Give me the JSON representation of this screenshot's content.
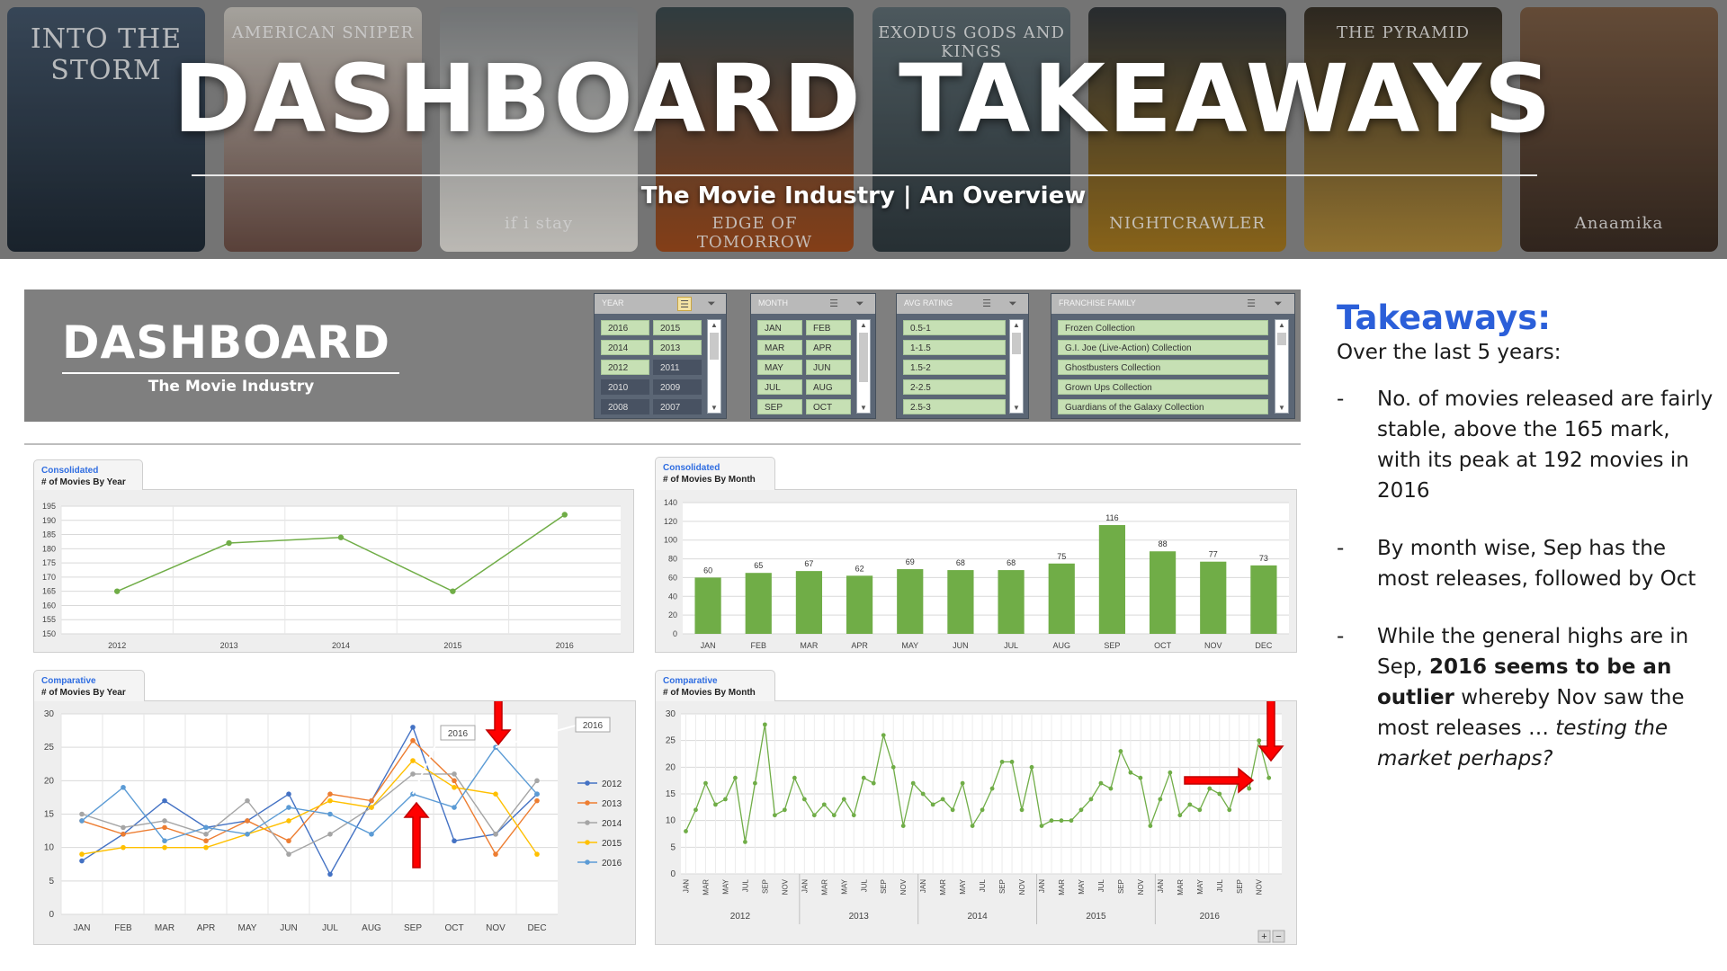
{
  "banner": {
    "title": "DASHBOARD TAKEAWAYS",
    "subtitle": "The Movie Industry | An Overview",
    "posters": [
      {
        "caption": "INTO THE STORM",
        "color_top": "#44566a",
        "color_bottom": "#1f2a35"
      },
      {
        "caption": "AMERICAN SNIPER",
        "color_top": "#c9c6bf",
        "color_bottom": "#6d4f46"
      },
      {
        "caption": "if i stay",
        "color_top": "#8a8d8f",
        "color_bottom": "#e5e2dc"
      },
      {
        "caption": "EDGE OF TOMORROW",
        "color_top": "#3a4a4e",
        "color_bottom": "#a14c1d"
      },
      {
        "caption": "EXODUS GODS AND KINGS",
        "color_top": "#5e6d73",
        "color_bottom": "#2f3a3f"
      },
      {
        "caption": "NIGHTCRAWLER",
        "color_top": "#30353a",
        "color_bottom": "#a6791f"
      },
      {
        "caption": "THE PYRAMID",
        "color_top": "#363028",
        "color_bottom": "#b08a3a"
      },
      {
        "caption": "Anaamika",
        "color_top": "#7a5c44",
        "color_bottom": "#3b2d24"
      }
    ]
  },
  "dashboard": {
    "title": "DASHBOARD",
    "subtitle": "The Movie Industry",
    "slicers": {
      "year": {
        "title": "YEAR",
        "items": [
          "2016",
          "2015",
          "2014",
          "2013",
          "2012",
          "2011",
          "2010",
          "2009",
          "2008",
          "2007"
        ],
        "selected": [
          "2016",
          "2015",
          "2014",
          "2013",
          "2012"
        ]
      },
      "month": {
        "title": "MONTH",
        "items": [
          "JAN",
          "FEB",
          "MAR",
          "APR",
          "MAY",
          "JUN",
          "JUL",
          "AUG",
          "SEP",
          "OCT"
        ]
      },
      "rating": {
        "title": "AVG RATING",
        "items": [
          "0.5-1",
          "1-1.5",
          "1.5-2",
          "2-2.5",
          "2.5-3"
        ]
      },
      "franchise": {
        "title": "FRANCHISE FAMILY",
        "items": [
          "Frozen Collection",
          "G.I. Joe (Live-Action) Collection",
          "Ghostbusters Collection",
          "Grown Ups Collection",
          "Guardians of the Galaxy Collection"
        ]
      }
    }
  },
  "panels": {
    "by_year": {
      "kicker": "Consolidated",
      "title": "# of Movies By Year"
    },
    "by_month": {
      "kicker": "Consolidated",
      "title": "# of Movies By Month"
    },
    "comp_year": {
      "kicker": "Comparative",
      "title": "# of Movies By Year"
    },
    "comp_month": {
      "kicker": "Comparative",
      "title": "# of Movies By Month"
    }
  },
  "chart_data": [
    {
      "type": "line",
      "title": "# of Movies By Year",
      "x": [
        "2012",
        "2013",
        "2014",
        "2015",
        "2016"
      ],
      "values": [
        165,
        182,
        184,
        165,
        192
      ],
      "ylim": [
        150,
        195
      ],
      "yticks": [
        150,
        155,
        160,
        165,
        170,
        175,
        180,
        185,
        190,
        195
      ],
      "color": "#70ad47",
      "grid": true
    },
    {
      "type": "bar",
      "title": "# of Movies By Month",
      "categories": [
        "JAN",
        "FEB",
        "MAR",
        "APR",
        "MAY",
        "JUN",
        "JUL",
        "AUG",
        "SEP",
        "OCT",
        "NOV",
        "DEC"
      ],
      "values": [
        60,
        65,
        67,
        62,
        69,
        68,
        68,
        75,
        116,
        88,
        77,
        73
      ],
      "ylim": [
        0,
        140
      ],
      "yticks": [
        0,
        20,
        40,
        60,
        80,
        100,
        120,
        140
      ],
      "color": "#70ad47",
      "data_labels": true,
      "grid": true
    },
    {
      "type": "line",
      "title": "# of Movies By Year",
      "categories": [
        "JAN",
        "FEB",
        "MAR",
        "APR",
        "MAY",
        "JUN",
        "JUL",
        "AUG",
        "SEP",
        "OCT",
        "NOV",
        "DEC"
      ],
      "ylim": [
        0,
        30
      ],
      "yticks": [
        0,
        5,
        10,
        15,
        20,
        25,
        30
      ],
      "legend": "right",
      "series": [
        {
          "name": "2012",
          "color": "#4472c4",
          "values": [
            8,
            12,
            17,
            13,
            14,
            18,
            6,
            17,
            28,
            11,
            12,
            18
          ]
        },
        {
          "name": "2013",
          "color": "#ed7d31",
          "values": [
            14,
            12,
            13,
            11,
            14,
            11,
            18,
            17,
            26,
            20,
            9,
            17
          ]
        },
        {
          "name": "2014",
          "color": "#a5a5a5",
          "values": [
            15,
            13,
            14,
            12,
            17,
            9,
            12,
            16,
            21,
            21,
            12,
            20
          ]
        },
        {
          "name": "2015",
          "color": "#ffc000",
          "values": [
            9,
            10,
            10,
            10,
            12,
            14,
            17,
            16,
            23,
            19,
            18,
            9
          ]
        },
        {
          "name": "2016",
          "color": "#5b9bd5",
          "values": [
            14,
            19,
            11,
            13,
            12,
            16,
            15,
            12,
            18,
            16,
            25,
            18
          ]
        }
      ],
      "annotations": [
        "2016",
        "2016"
      ]
    },
    {
      "type": "line",
      "title": "# of Movies By Month",
      "ylim": [
        0,
        30
      ],
      "yticks": [
        0,
        5,
        10,
        15,
        20,
        25,
        30
      ],
      "color": "#70ad47",
      "x_months": [
        "JAN",
        "FEB",
        "MAR",
        "APR",
        "MAY",
        "JUN",
        "JUL",
        "AUG",
        "SEP",
        "OCT",
        "NOV",
        "DEC"
      ],
      "x_months_last_year": [
        "JAN",
        "FEB",
        "MAR",
        "APR",
        "MAY",
        "JUN",
        "JUL",
        "AUG",
        "SEP",
        "OCT",
        "NOV"
      ],
      "years": [
        "2012",
        "2013",
        "2014",
        "2015",
        "2016"
      ],
      "values": [
        8,
        12,
        17,
        13,
        14,
        18,
        6,
        17,
        28,
        11,
        12,
        18,
        14,
        11,
        13,
        11,
        14,
        11,
        18,
        17,
        26,
        20,
        9,
        17,
        15,
        13,
        14,
        12,
        17,
        9,
        12,
        16,
        21,
        21,
        12,
        20,
        9,
        10,
        10,
        10,
        12,
        14,
        17,
        16,
        23,
        19,
        18,
        9,
        14,
        19,
        11,
        13,
        12,
        16,
        15,
        12,
        18,
        16,
        25,
        18
      ]
    }
  ],
  "takeaways": {
    "title": "Takeaways",
    "colon": ":",
    "intro": "Over the last 5 years:",
    "dash": "-",
    "item1": "No. of movies released are fairly stable, above the 165 mark, with its peak at 192 movies in 2016",
    "item2": "By month wise, Sep has the most releases, followed by Oct",
    "item3_a": "While the general highs are in Sep, ",
    "item3_b": "2016 seems to be an outlier",
    "item3_c": " whereby Nov saw the most releases … ",
    "item3_d": "testing the market perhaps?"
  },
  "zoom_controls": {
    "plus": "+",
    "minus": "−"
  }
}
